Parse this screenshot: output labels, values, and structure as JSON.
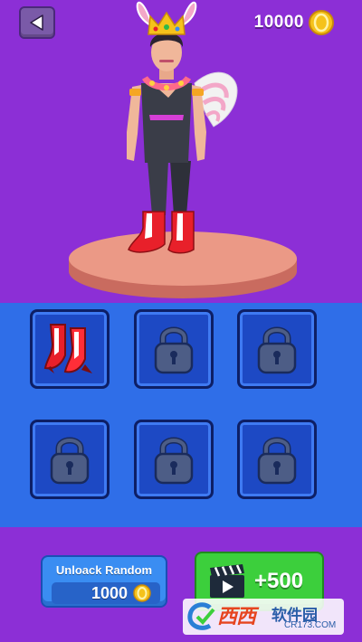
{
  "header": {
    "coins": "10000"
  },
  "icons": {
    "back": "back-arrow-icon",
    "coin": "coin-icon",
    "lock": "lock-icon",
    "video": "clapperboard-icon"
  },
  "items": [
    {
      "state": "unlocked",
      "content": "red-boots"
    },
    {
      "state": "locked"
    },
    {
      "state": "locked"
    },
    {
      "state": "locked"
    },
    {
      "state": "locked"
    },
    {
      "state": "locked"
    }
  ],
  "unlock_random": {
    "label": "Unloack Random",
    "cost": "1000"
  },
  "watch_video": {
    "reward": "+500"
  },
  "watermark": {
    "brand": "西西",
    "site": "软件园",
    "url": "CR173.COM"
  },
  "colors": {
    "background": "#8c2fd6",
    "panel": "#2f6ee8",
    "slot": "#1d49c4",
    "green_button": "#3ccf3c",
    "blue_button": "#3a8df2",
    "coin": "#f5c21b"
  }
}
